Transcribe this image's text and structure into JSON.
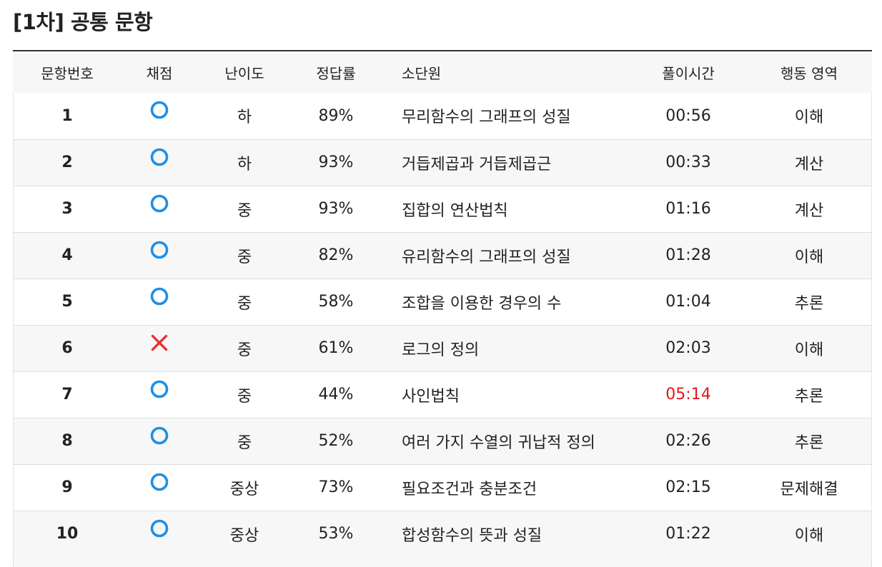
{
  "title": "[1차] 공통 문항",
  "colors": {
    "correct_mark": "#1e8fe6",
    "wrong_mark": "#e8333a",
    "overtime": "#e0191c",
    "row_alt": "#f7f7f7"
  },
  "table": {
    "headers": {
      "num": "문항번호",
      "grade": "채점",
      "difficulty": "난이도",
      "rate": "정답률",
      "unit": "소단원",
      "time": "풀이시간",
      "domain": "행동 영역"
    },
    "rows": [
      {
        "num": "1",
        "grade": "correct",
        "grade_icon": "circle-icon",
        "difficulty": "하",
        "rate": "89%",
        "unit": "무리함수의 그래프의 성질",
        "time": "00:56",
        "overtime": false,
        "domain": "이해"
      },
      {
        "num": "2",
        "grade": "correct",
        "grade_icon": "circle-icon",
        "difficulty": "하",
        "rate": "93%",
        "unit": "거듭제곱과 거듭제곱근",
        "time": "00:33",
        "overtime": false,
        "domain": "계산"
      },
      {
        "num": "3",
        "grade": "correct",
        "grade_icon": "circle-icon",
        "difficulty": "중",
        "rate": "93%",
        "unit": "집합의 연산법칙",
        "time": "01:16",
        "overtime": false,
        "domain": "계산"
      },
      {
        "num": "4",
        "grade": "correct",
        "grade_icon": "circle-icon",
        "difficulty": "중",
        "rate": "82%",
        "unit": "유리함수의 그래프의 성질",
        "time": "01:28",
        "overtime": false,
        "domain": "이해"
      },
      {
        "num": "5",
        "grade": "correct",
        "grade_icon": "circle-icon",
        "difficulty": "중",
        "rate": "58%",
        "unit": "조합을 이용한 경우의 수",
        "time": "01:04",
        "overtime": false,
        "domain": "추론"
      },
      {
        "num": "6",
        "grade": "wrong",
        "grade_icon": "x-icon",
        "difficulty": "중",
        "rate": "61%",
        "unit": "로그의 정의",
        "time": "02:03",
        "overtime": false,
        "domain": "이해"
      },
      {
        "num": "7",
        "grade": "correct",
        "grade_icon": "circle-icon",
        "difficulty": "중",
        "rate": "44%",
        "unit": "사인법칙",
        "time": "05:14",
        "overtime": true,
        "domain": "추론"
      },
      {
        "num": "8",
        "grade": "correct",
        "grade_icon": "circle-icon",
        "difficulty": "중",
        "rate": "52%",
        "unit": "여러 가지 수열의 귀납적 정의",
        "time": "02:26",
        "overtime": false,
        "domain": "추론"
      },
      {
        "num": "9",
        "grade": "correct",
        "grade_icon": "circle-icon",
        "difficulty": "중상",
        "rate": "73%",
        "unit": "필요조건과 충분조건",
        "time": "02:15",
        "overtime": false,
        "domain": "문제해결"
      },
      {
        "num": "10",
        "grade": "correct",
        "grade_icon": "circle-icon",
        "difficulty": "중상",
        "rate": "53%",
        "unit": "합성함수의 뜻과 성질",
        "time": "01:22",
        "overtime": false,
        "domain": "이해"
      }
    ]
  }
}
